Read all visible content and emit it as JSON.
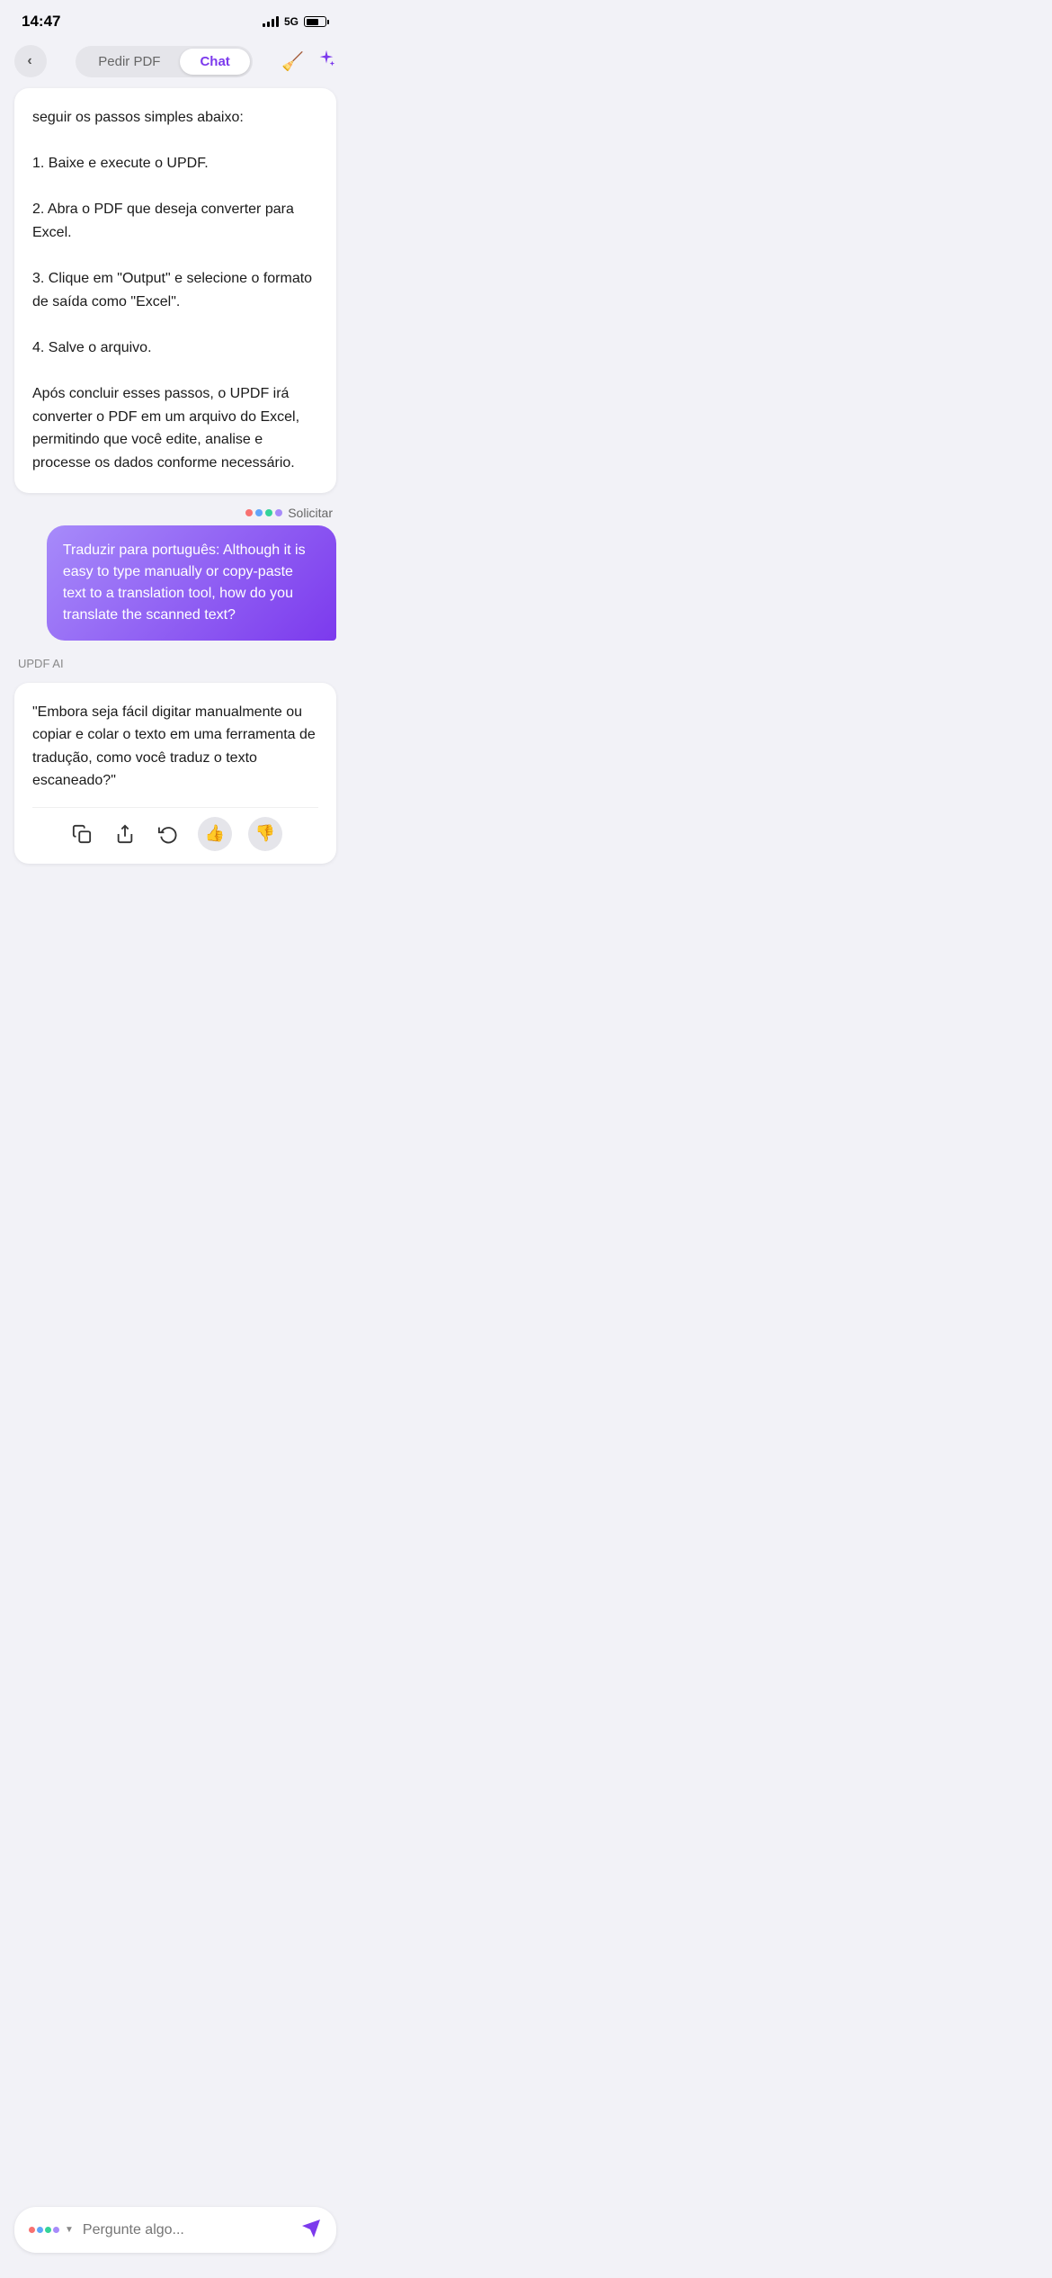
{
  "statusBar": {
    "time": "14:47",
    "network": "5G"
  },
  "nav": {
    "backLabel": "‹",
    "tab1": "Pedir PDF",
    "tab2": "Chat",
    "activeTab": "Chat"
  },
  "aiResponse": {
    "text": "seguir os passos simples abaixo:\n\n1. Baixe e execute o UPDF.\n\n2. Abra o PDF que deseja converter para Excel.\n\n3. Clique em \"Output\" e selecione o formato de saída como \"Excel\".\n\n4. Salve o arquivo.\n\nApós concluir esses passos, o UPDF irá converter o PDF em um arquivo do Excel, permitindo que você edite, analise e processe os dados conforme necessário."
  },
  "solicitarLabel": "Solicitar",
  "userMessage": {
    "text": "Traduzir para português: Although it is easy to type manually or copy-paste text to a translation tool, how do you translate the scanned text?"
  },
  "aiLabel": "UPDF AI",
  "aiReply": {
    "text": "\"Embora seja fácil digitar manualmente ou copiar e colar o texto em uma ferramenta de tradução, como você traduz o texto escaneado?\""
  },
  "actionBar": {
    "copy": "⧉",
    "share": "↑",
    "refresh": "↺",
    "thumbsUp": "👍",
    "thumbsDown": "👎"
  },
  "input": {
    "placeholder": "Pergunte algo..."
  },
  "dots": {
    "colors": [
      "#f87171",
      "#60a5fa",
      "#34d399",
      "#a78bfa"
    ]
  }
}
